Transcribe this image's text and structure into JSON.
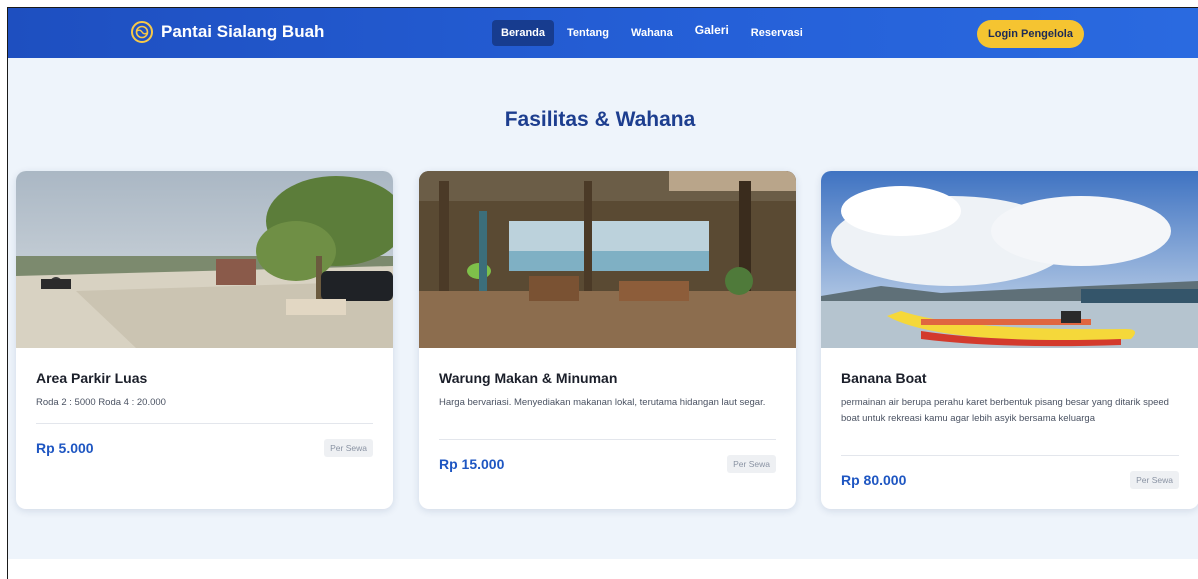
{
  "brand": {
    "name": "Pantai Sialang Buah",
    "logo_icon": "globe-icon"
  },
  "nav": {
    "items": [
      {
        "label": "Beranda",
        "active": true
      },
      {
        "label": "Tentang",
        "active": false
      },
      {
        "label": "Wahana",
        "active": false
      },
      {
        "label": "Galeri",
        "active": false
      },
      {
        "label": "Reservasi",
        "active": false
      }
    ],
    "login_label": "Login Pengelola"
  },
  "section": {
    "title": "Fasilitas & Wahana"
  },
  "cards": [
    {
      "title": "Area Parkir Luas",
      "desc": "Roda 2 : 5000 Roda 4 : 20.000",
      "price": "Rp 5.000",
      "tag": "Per Sewa"
    },
    {
      "title": "Warung Makan & Minuman",
      "desc": "Harga bervariasi. Menyediakan makanan lokal, terutama hidangan laut segar.",
      "price": "Rp 15.000",
      "tag": "Per Sewa"
    },
    {
      "title": "Banana Boat",
      "desc": "permainan air berupa perahu karet berbentuk pisang besar yang ditarik speed boat untuk rekreasi kamu agar lebih asyik bersama keluarga",
      "price": "Rp 80.000",
      "tag": "Per Sewa"
    }
  ],
  "colors": {
    "nav": "#2560d8",
    "accent": "#f5c431",
    "title": "#1d3e8f",
    "price": "#1e56c2"
  }
}
